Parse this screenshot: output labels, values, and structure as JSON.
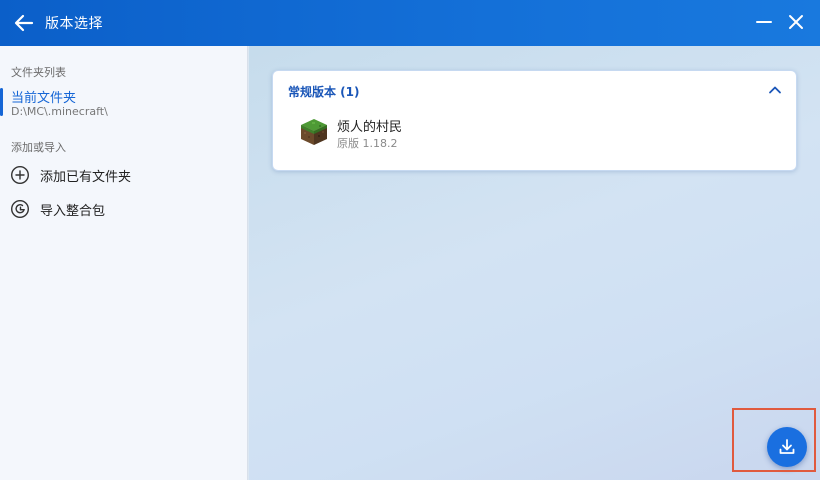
{
  "window": {
    "title": "版本选择"
  },
  "sidebar": {
    "folder_section_label": "文件夹列表",
    "current_folder": {
      "title": "当前文件夹",
      "path": "D:\\MC\\.minecraft\\"
    },
    "add_section_label": "添加或导入",
    "actions": [
      {
        "label": "添加已有文件夹",
        "icon": "plus-circle-icon"
      },
      {
        "label": "导入整合包",
        "icon": "modpack-icon"
      }
    ]
  },
  "main": {
    "group": {
      "title": "常规版本 (1)",
      "expanded": true,
      "versions": [
        {
          "name": "烦人的村民",
          "subtitle": "原版 1.18.2",
          "icon": "grass-block-icon"
        }
      ]
    }
  },
  "colors": {
    "accent": "#1566d6",
    "titlebar": "#0b5fc9",
    "highlight": "#e05a3e"
  }
}
